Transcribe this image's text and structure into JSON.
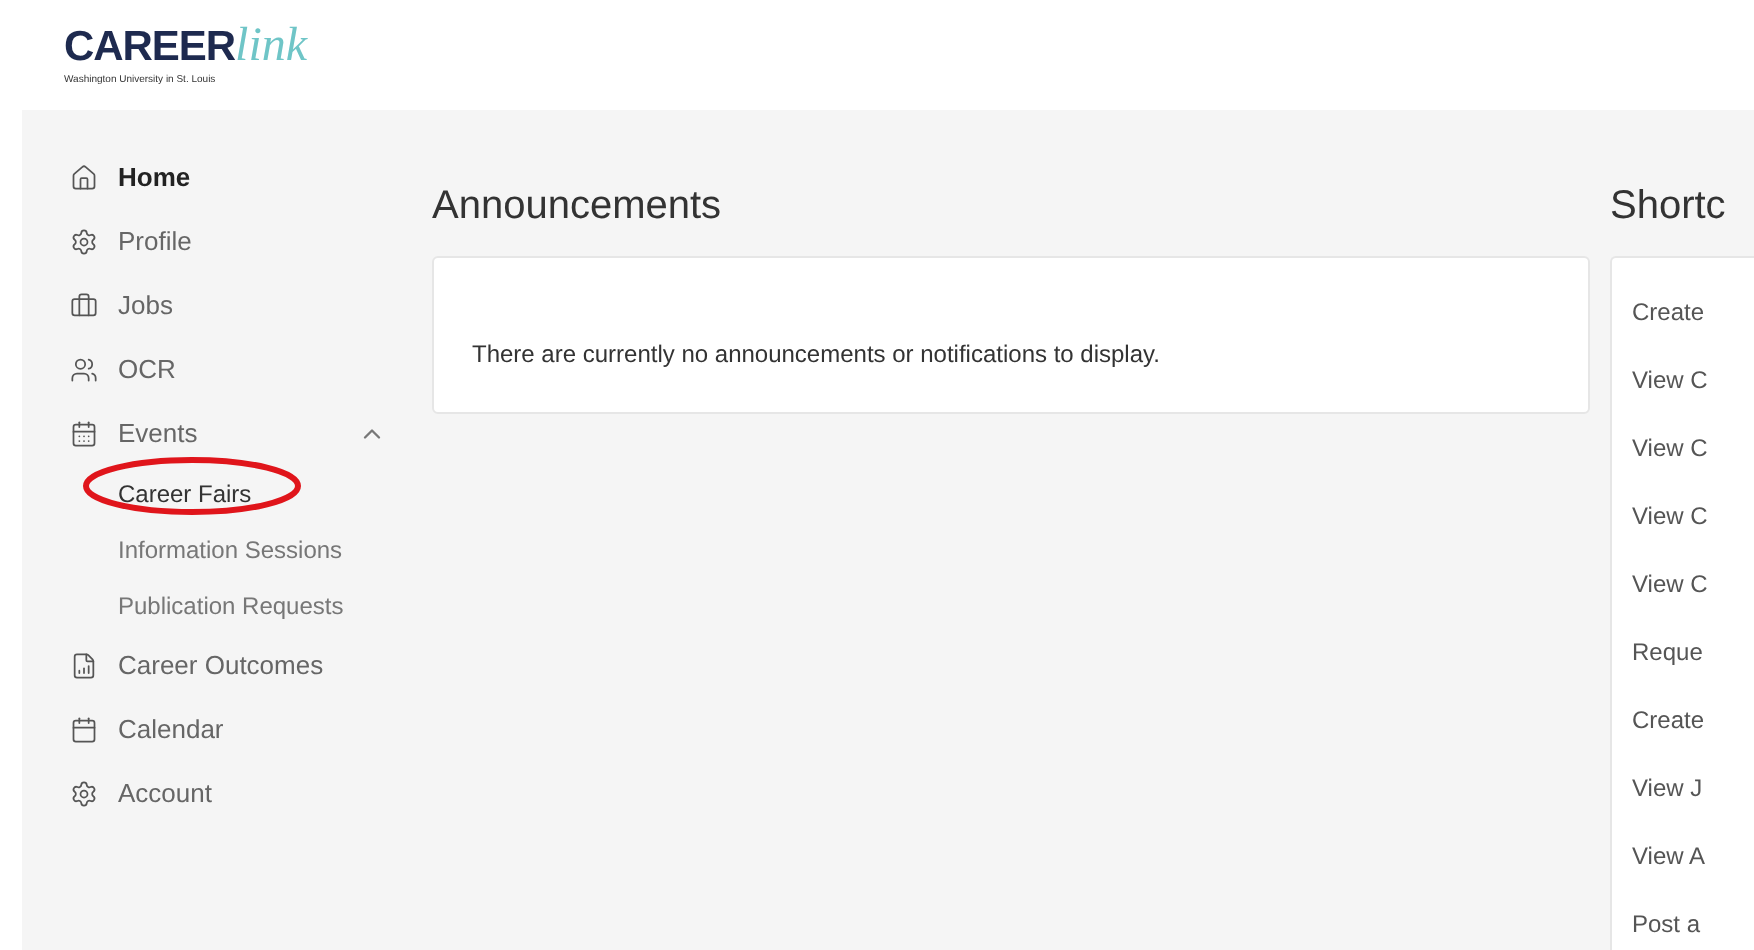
{
  "logo": {
    "word_bold": "CAREER",
    "word_script": "link",
    "subtitle": "Washington University in St. Louis"
  },
  "sidebar": {
    "items": [
      {
        "label": "Home",
        "selected": true
      },
      {
        "label": "Profile",
        "selected": false
      },
      {
        "label": "Jobs",
        "selected": false
      },
      {
        "label": "OCR",
        "selected": false
      },
      {
        "label": "Events",
        "selected": false,
        "expanded": true,
        "children": [
          {
            "label": "Career Fairs",
            "selected": true
          },
          {
            "label": "Information Sessions",
            "selected": false
          },
          {
            "label": "Publication Requests",
            "selected": false
          }
        ]
      },
      {
        "label": "Career Outcomes",
        "selected": false
      },
      {
        "label": "Calendar",
        "selected": false
      },
      {
        "label": "Account",
        "selected": false
      }
    ]
  },
  "announcements": {
    "title": "Announcements",
    "message": "There are currently no announcements or notifications to display."
  },
  "shortcuts": {
    "title": "Shortc",
    "items": [
      "Create",
      "View C",
      "View C",
      "View C",
      "View C",
      "Reque",
      "Create",
      "View J",
      "View A",
      "Post a"
    ]
  }
}
